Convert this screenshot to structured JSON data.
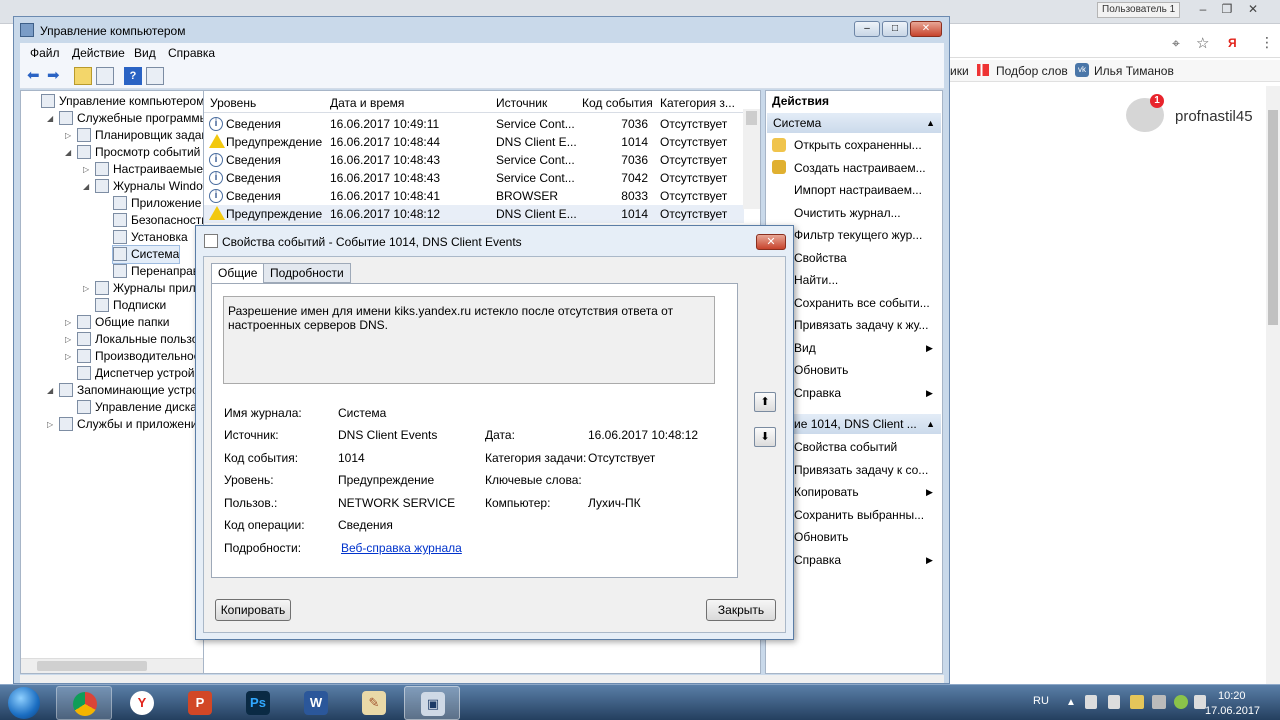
{
  "browser": {
    "user_badge": "Пользователь 1",
    "bookmarks": [
      "ики",
      "Подбор слов",
      "Илья Тиманов"
    ],
    "profile_name": "profnastil45",
    "notification_count": "1",
    "yandex_glyph": "Я"
  },
  "mmc": {
    "title": "Управление компьютером",
    "menu": [
      "Файл",
      "Действие",
      "Вид",
      "Справка"
    ],
    "tree": [
      {
        "label": "Управление компьютером (л",
        "indent": 0,
        "arrow": ""
      },
      {
        "label": "Служебные программы",
        "indent": 1,
        "arrow": "open"
      },
      {
        "label": "Планировщик заданий",
        "indent": 2,
        "arrow": "closed"
      },
      {
        "label": "Просмотр событий",
        "indent": 2,
        "arrow": "open"
      },
      {
        "label": "Настраиваемые пр",
        "indent": 3,
        "arrow": "closed"
      },
      {
        "label": "Журналы Windows",
        "indent": 3,
        "arrow": "open"
      },
      {
        "label": "Приложение",
        "indent": 4,
        "arrow": ""
      },
      {
        "label": "Безопасность",
        "indent": 4,
        "arrow": ""
      },
      {
        "label": "Установка",
        "indent": 4,
        "arrow": ""
      },
      {
        "label": "Система",
        "indent": 4,
        "arrow": "",
        "selected": true
      },
      {
        "label": "Перенаправлен",
        "indent": 4,
        "arrow": ""
      },
      {
        "label": "Журналы приложе",
        "indent": 3,
        "arrow": "closed"
      },
      {
        "label": "Подписки",
        "indent": 3,
        "arrow": ""
      },
      {
        "label": "Общие папки",
        "indent": 2,
        "arrow": "closed"
      },
      {
        "label": "Локальные пользовате",
        "indent": 2,
        "arrow": "closed"
      },
      {
        "label": "Производительность",
        "indent": 2,
        "arrow": "closed"
      },
      {
        "label": "Диспетчер устройств",
        "indent": 2,
        "arrow": ""
      },
      {
        "label": "Запоминающие устройст",
        "indent": 1,
        "arrow": "open"
      },
      {
        "label": "Управление дисками",
        "indent": 2,
        "arrow": ""
      },
      {
        "label": "Службы и приложения",
        "indent": 1,
        "arrow": "closed"
      }
    ],
    "grid": {
      "columns": [
        "Уровень",
        "Дата и время",
        "Источник",
        "Код события",
        "Категория з..."
      ],
      "rows": [
        {
          "level": "Сведения",
          "type": "info",
          "date": "16.06.2017 10:49:11",
          "source": "Service Cont...",
          "code": "7036",
          "category": "Отсутствует"
        },
        {
          "level": "Предупреждение",
          "type": "warn",
          "date": "16.06.2017 10:48:44",
          "source": "DNS Client E...",
          "code": "1014",
          "category": "Отсутствует"
        },
        {
          "level": "Сведения",
          "type": "info",
          "date": "16.06.2017 10:48:43",
          "source": "Service Cont...",
          "code": "7036",
          "category": "Отсутствует"
        },
        {
          "level": "Сведения",
          "type": "info",
          "date": "16.06.2017 10:48:43",
          "source": "Service Cont...",
          "code": "7042",
          "category": "Отсутствует"
        },
        {
          "level": "Сведения",
          "type": "info",
          "date": "16.06.2017 10:48:41",
          "source": "BROWSER",
          "code": "8033",
          "category": "Отсутствует"
        },
        {
          "level": "Предупреждение",
          "type": "warn",
          "date": "16.06.2017 10:48:12",
          "source": "DNS Client E...",
          "code": "1014",
          "category": "Отсутствует"
        }
      ]
    },
    "actions": {
      "header": "Действия",
      "section1": "Система",
      "items1": [
        "Открыть сохраненны...",
        "Создать настраиваем...",
        "Импорт настраиваем...",
        "Очистить журнал...",
        "Фильтр текущего жур...",
        "Свойства",
        "Найти...",
        "Сохранить все событи...",
        "Привязать задачу к жу...",
        "Вид",
        "Обновить",
        "Справка"
      ],
      "section2": "бытие 1014, DNS Client ...",
      "items2": [
        "Свойства событий",
        "Привязать задачу к со...",
        "Копировать",
        "Сохранить выбранны...",
        "Обновить",
        "Справка"
      ]
    }
  },
  "dialog": {
    "title": "Свойства событий - Событие 1014, DNS Client Events",
    "close_glyph": "✕",
    "tabs": [
      "Общие",
      "Подробности"
    ],
    "description": "Разрешение имен для имени kiks.yandex.ru истекло после отсутствия ответа от настроенных серверов DNS.",
    "fields": {
      "log_name_label": "Имя журнала:",
      "log_name": "Система",
      "source_label": "Источник:",
      "source": "DNS Client Events",
      "date_label": "Дата:",
      "date": "16.06.2017 10:48:12",
      "event_id_label": "Код события:",
      "event_id": "1014",
      "task_cat_label": "Категория задачи:",
      "task_cat": "Отсутствует",
      "level_label": "Уровень:",
      "level": "Предупреждение",
      "keywords_label": "Ключевые слова:",
      "user_label": "Пользов.:",
      "user": "NETWORK SERVICE",
      "computer_label": "Компьютер:",
      "computer": "Лухич-ПК",
      "opcode_label": "Код операции:",
      "opcode": "Сведения",
      "more_label": "Подробности:",
      "more_link": "Веб-справка журнала"
    },
    "copy_button": "Копировать",
    "close_button": "Закрыть"
  },
  "taskbar": {
    "lang": "RU",
    "time": "10:20",
    "date": "17.06.2017",
    "apps": [
      "chrome",
      "yandex",
      "powerpoint",
      "photoshop",
      "word",
      "paint",
      "mmc"
    ]
  }
}
